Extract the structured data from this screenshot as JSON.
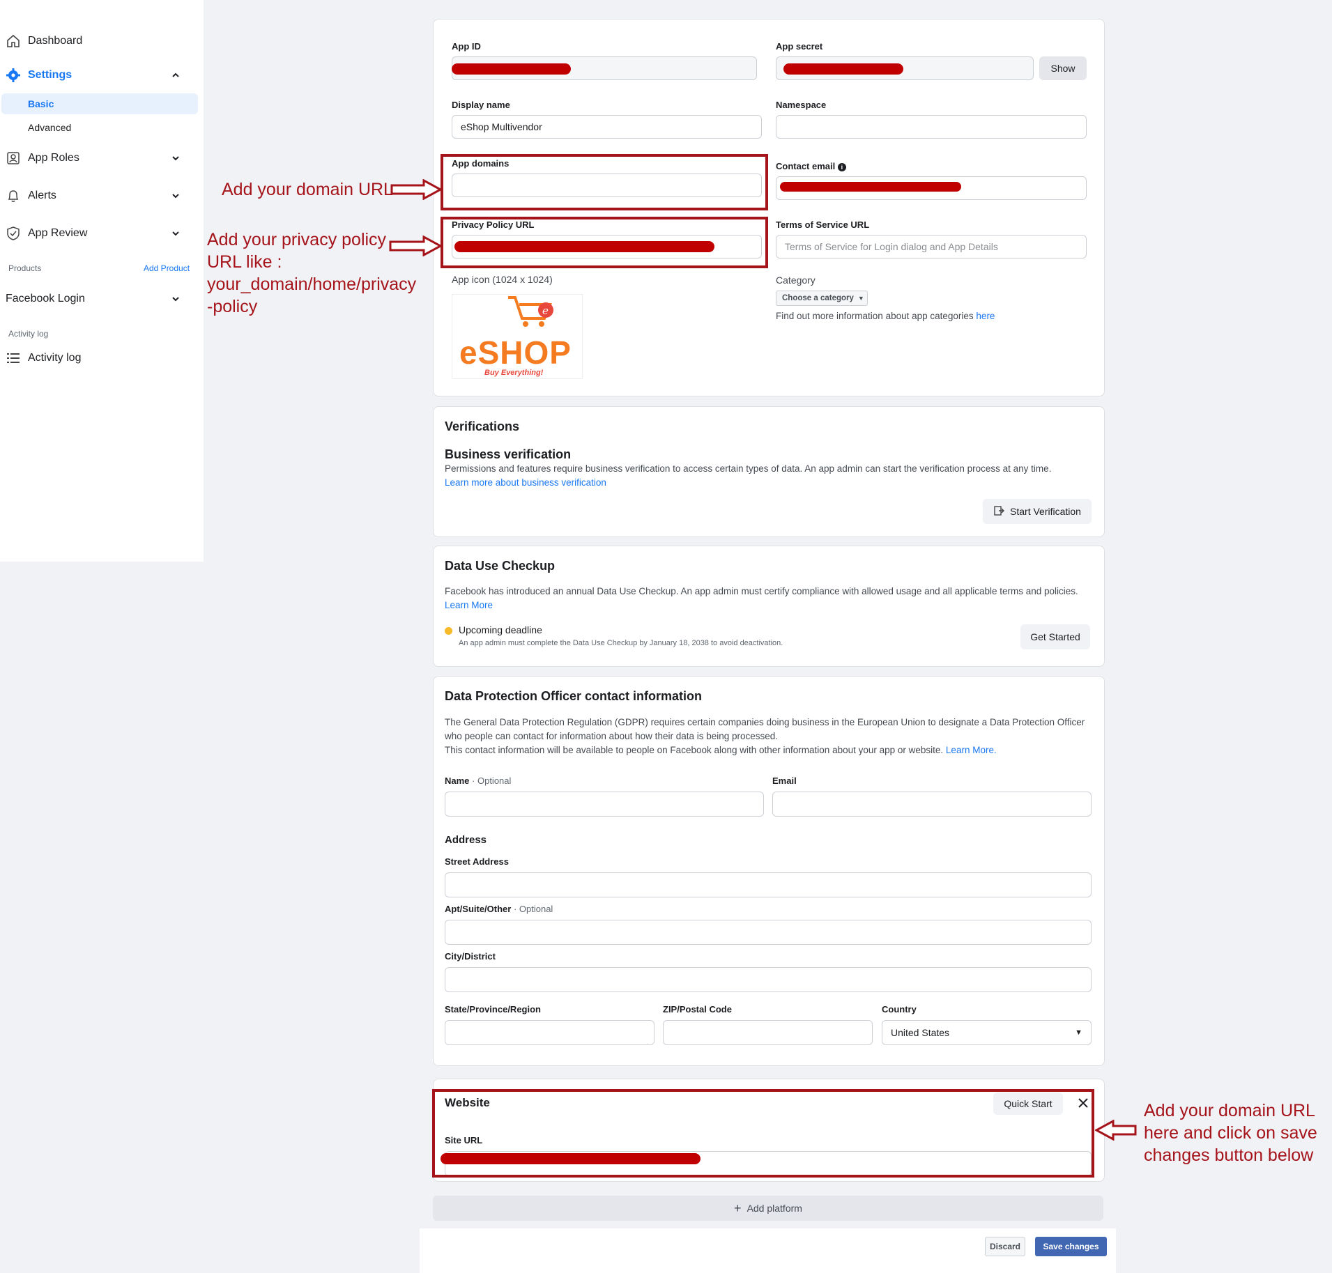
{
  "sidebar": {
    "dashboard": "Dashboard",
    "settings": "Settings",
    "basic": "Basic",
    "advanced": "Advanced",
    "app_roles": "App Roles",
    "alerts": "Alerts",
    "app_review": "App Review",
    "products_label": "Products",
    "add_product": "Add Product",
    "facebook_login": "Facebook Login",
    "activity_log_label": "Activity log",
    "activity_log": "Activity log"
  },
  "basic": {
    "app_id_label": "App ID",
    "app_secret_label": "App secret",
    "show_button": "Show",
    "display_name_label": "Display name",
    "display_name_value": "eShop Multivendor",
    "namespace_label": "Namespace",
    "app_domains_label": "App domains",
    "contact_email_label": "Contact email",
    "privacy_policy_label": "Privacy Policy URL",
    "terms_label": "Terms of Service URL",
    "terms_placeholder": "Terms of Service for Login dialog and App Details",
    "app_icon_label": "App icon (1024 x 1024)",
    "category_label": "Category",
    "category_select": "Choose a category",
    "category_info": "Find out more information about app categories ",
    "category_link": "here",
    "logo_text": "eSHOP",
    "logo_tagline": "Buy Everything!"
  },
  "verifications": {
    "title": "Verifications",
    "subtitle": "Business verification",
    "text": "Permissions and features require business verification to access certain types of data. An app admin can start the verification process at any time.",
    "link": "Learn more about business verification",
    "button": "Start Verification"
  },
  "data_use": {
    "title": "Data Use Checkup",
    "text": "Facebook has introduced an annual Data Use Checkup. An app admin must certify compliance with allowed usage and all applicable terms and policies. ",
    "link": "Learn More",
    "deadline_title": "Upcoming deadline",
    "deadline_text": "An app admin must complete the Data Use Checkup by January 18, 2038 to avoid deactivation.",
    "button": "Get Started",
    "status_color": "#f7b928"
  },
  "dpo": {
    "title": "Data Protection Officer contact information",
    "text1": "The General Data Protection Regulation (GDPR) requires certain companies doing business in the European Union to designate a Data Protection Officer who people can contact for information about how their data is being processed.",
    "text2": "This contact information will be available to people on Facebook along with other information about your app or website. ",
    "link": "Learn More.",
    "name_label": "Name",
    "optional": " · Optional",
    "email_label": "Email",
    "address_label": "Address",
    "street_label": "Street Address",
    "apt_label": "Apt/Suite/Other",
    "city_label": "City/District",
    "state_label": "State/Province/Region",
    "zip_label": "ZIP/Postal Code",
    "country_label": "Country",
    "country_value": "United States"
  },
  "website": {
    "title": "Website",
    "quick_start": "Quick Start",
    "site_url_label": "Site URL"
  },
  "add_platform": "Add platform",
  "footer": {
    "discard": "Discard",
    "save": "Save changes"
  },
  "annotations": {
    "domain": "Add your domain URL",
    "privacy": [
      "Add your privacy policy",
      "URL like :",
      "your_domain/home/privacy",
      "-policy"
    ],
    "website": [
      "Add your domain URL",
      "here and click on save",
      "changes button below"
    ],
    "color": "#a6141b"
  },
  "colors": {
    "accent": "#1877f2",
    "redaction": "#c00000"
  }
}
